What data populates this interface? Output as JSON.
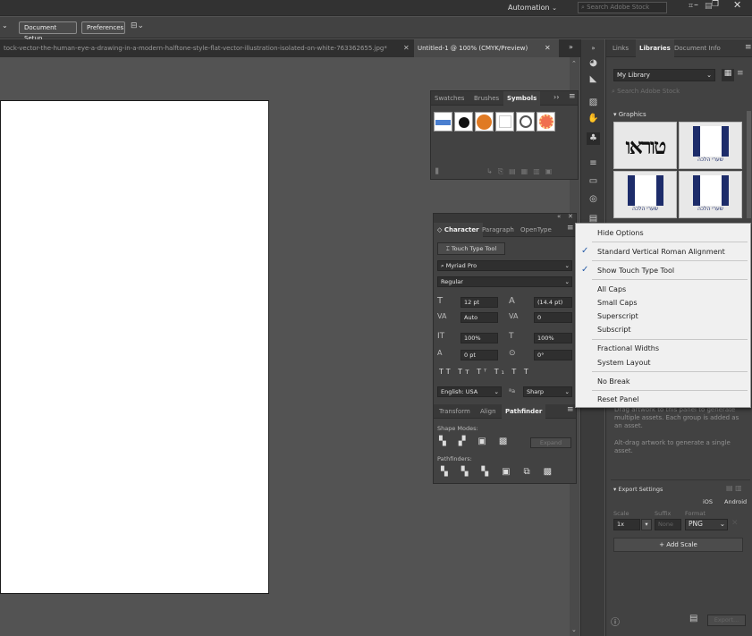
{
  "app_bar": {
    "workspace": "Automation",
    "search_placeholder": "Search Adobe Stock"
  },
  "control_bar": {
    "document_setup": "Document Setup",
    "preferences": "Preferences"
  },
  "doc_tabs": [
    {
      "label": "tock-vector-the-human-eye-a-drawing-in-a-modern-halftone-style-flat-vector-illustration-isolated-on-white-763362655.jpg*"
    },
    {
      "label": "Untitled-1 @ 100% (CMYK/Preview)"
    }
  ],
  "symbols_panel": {
    "tabs": [
      "Swatches",
      "Brushes",
      "Symbols"
    ],
    "active_tab": "Symbols",
    "symbol_colors": [
      "#4a7fd0",
      "#111111",
      "#e07a23",
      "#ffffff",
      "#555555",
      "#f07050"
    ]
  },
  "character_panel": {
    "tabs": [
      "Character",
      "Paragraph",
      "OpenType"
    ],
    "touch_type_tool": "Touch Type Tool",
    "font_family": "Myriad Pro",
    "font_style": "Regular",
    "font_size": "12 pt",
    "leading": "(14.4 pt)",
    "kerning": "Auto",
    "tracking": "0",
    "vertical_scale": "100%",
    "horizontal_scale": "100%",
    "baseline_shift": "0 pt",
    "rotation": "0°",
    "language": "English: USA",
    "anti_alias": "Sharp"
  },
  "pathfinder_panel": {
    "tabs": [
      "Transform",
      "Align",
      "Pathfinder"
    ],
    "shape_modes_label": "Shape Modes:",
    "expand_label": "Expand",
    "pathfinders_label": "Pathfinders:"
  },
  "flyout_menu": {
    "items": [
      {
        "label": "Hide Options",
        "checked": false
      },
      {
        "label": "Standard Vertical Roman Alignment",
        "checked": true
      },
      {
        "label": "Show Touch Type Tool",
        "checked": true
      },
      {
        "label": "All Caps",
        "checked": false
      },
      {
        "label": "Small Caps",
        "checked": false
      },
      {
        "label": "Superscript",
        "checked": false
      },
      {
        "label": "Subscript",
        "checked": false
      },
      {
        "label": "Fractional Widths",
        "checked": false
      },
      {
        "label": "System Layout",
        "checked": false
      },
      {
        "label": "No Break",
        "checked": false
      },
      {
        "label": "Reset Panel",
        "checked": false
      }
    ]
  },
  "libraries_panel": {
    "tabs": [
      "Links",
      "Libraries",
      "Document Info"
    ],
    "active_tab": "Libraries",
    "library_name": "My Library",
    "search_placeholder": "Search Adobe Stock",
    "section_graphics": "Graphics",
    "drag_hint": "Drag artwork to this panel to generate multiple assets. Each group is added as an asset.",
    "alt_drag_hint": "Alt-drag artwork to generate a single asset.",
    "export_settings": "Export Settings",
    "ios_label": "iOS",
    "android_label": "Android",
    "scale_label": "Scale",
    "suffix_label": "Suffix",
    "format_label": "Format",
    "scale_value": "1x",
    "suffix_placeholder": "None",
    "format_value": "PNG",
    "add_scale": "Add Scale",
    "export_button": "Export...",
    "thumb_texts": [
      "טוראו",
      "שערי הלכה",
      "שערי הלכה",
      "שערי הלכה"
    ]
  }
}
